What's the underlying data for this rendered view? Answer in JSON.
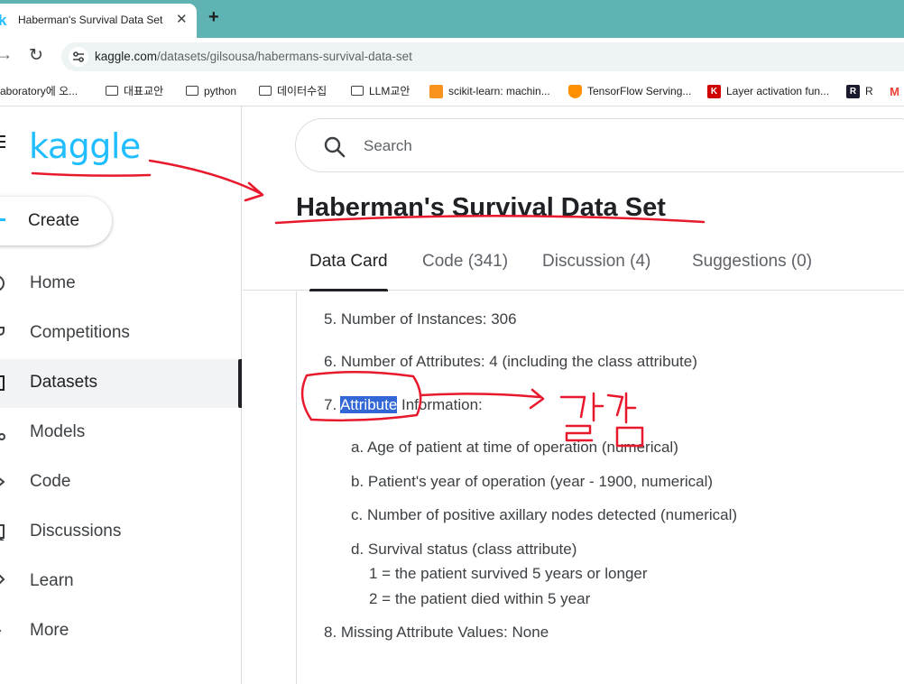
{
  "browser": {
    "tab": {
      "favicon": "k",
      "title": "Haberman's Survival Data Set",
      "close": "✕"
    },
    "new_tab": "+",
    "url": {
      "host": "kaggle.com",
      "path": "/datasets/gilsousa/habermans-survival-data-set"
    },
    "bookmarks": [
      {
        "label": "aboratory에 오...",
        "icon": "none"
      },
      {
        "label": "대표교안",
        "icon": "folder-icon"
      },
      {
        "label": "python",
        "icon": "folder-icon"
      },
      {
        "label": "데이터수집",
        "icon": "folder-icon"
      },
      {
        "label": "LLM교안",
        "icon": "folder-icon"
      },
      {
        "label": "scikit-learn: machin...",
        "icon": "scikit-learn-icon"
      },
      {
        "label": "TensorFlow Serving...",
        "icon": "tensorflow-icon"
      },
      {
        "label": "Layer activation fun...",
        "icon": "keras-icon",
        "glyph": "K"
      },
      {
        "label": "R",
        "icon": "r-icon",
        "glyph": "R"
      },
      {
        "label": "",
        "icon": "gmail-icon",
        "glyph": "M"
      }
    ]
  },
  "kaggle": {
    "logo": "kaggle",
    "create_label": "Create",
    "nav": [
      {
        "label": "Home",
        "icon": "home-icon",
        "active": false
      },
      {
        "label": "Competitions",
        "icon": "trophy-icon",
        "active": false
      },
      {
        "label": "Datasets",
        "icon": "table-icon",
        "active": true
      },
      {
        "label": "Models",
        "icon": "models-icon",
        "active": false
      },
      {
        "label": "Code",
        "icon": "code-icon",
        "active": false
      },
      {
        "label": "Discussions",
        "icon": "comment-icon",
        "active": false
      },
      {
        "label": "Learn",
        "icon": "school-icon",
        "active": false
      },
      {
        "label": "More",
        "icon": "expand-icon",
        "active": false
      }
    ],
    "search_placeholder": "Search",
    "title": "Haberman's Survival Data Set",
    "tabs": [
      {
        "label": "Data Card",
        "active": true
      },
      {
        "label": "Code (341)",
        "active": false
      },
      {
        "label": "Discussion (4)",
        "active": false
      },
      {
        "label": "Suggestions (0)",
        "active": false
      }
    ],
    "content": {
      "item5": "5. Number of Instances: 306",
      "item6": "6. Number of Attributes: 4 (including the class attribute)",
      "item7_prefix": "7. ",
      "item7_selected": "Attribute",
      "item7_suffix": " Information:",
      "sub_a": "a. Age of patient at time of operation (numerical)",
      "sub_b": "b. Patient's year of operation (year - 1900, numerical)",
      "sub_c": "c. Number of positive axillary nodes detected (numerical)",
      "sub_d": "d. Survival status (class attribute)",
      "sub_d1": "1 = the patient survived 5 years or longer",
      "sub_d2": "2 = the patient died within 5 year",
      "item8": "8. Missing Attribute Values: None"
    }
  },
  "annotations": {
    "handwritten_note": "칼럼",
    "ink_color": "#e8192c"
  },
  "colors": {
    "chrome_teal": "#5fb3b3",
    "kaggle_blue": "#20beff",
    "selection": "#3367d6"
  }
}
